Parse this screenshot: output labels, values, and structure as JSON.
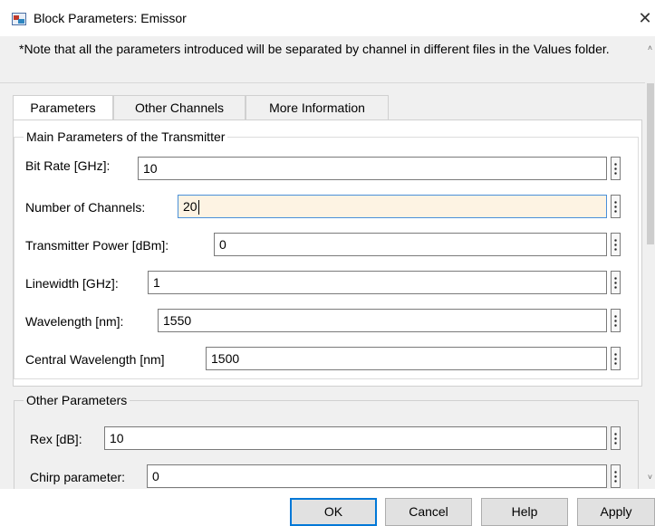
{
  "window": {
    "title": "Block Parameters: Emissor",
    "close_glyph": "✕"
  },
  "note": "*Note that all the parameters introduced will be separated by channel in different files in the Values folder.",
  "tabs": [
    {
      "label": "Parameters",
      "active": true
    },
    {
      "label": "Other Channels",
      "active": false
    },
    {
      "label": "More Information",
      "active": false
    }
  ],
  "main_group": {
    "title": "Main Parameters of the Transmitter",
    "fields": [
      {
        "label": "Bit Rate [GHz]:",
        "value": "10"
      },
      {
        "label": "Number of Channels:",
        "value": "20"
      },
      {
        "label": "Transmitter Power  [dBm]:",
        "value": "0"
      },
      {
        "label": "Linewidth [GHz]:",
        "value": "1"
      },
      {
        "label": "Wavelength [nm]:",
        "value": "1550"
      },
      {
        "label": "Central Wavelength [nm]",
        "value": "1500"
      }
    ]
  },
  "other_group": {
    "title": "Other Parameters",
    "fields": [
      {
        "label": "Rex [dB]:",
        "value": "10"
      },
      {
        "label": "Chirp parameter:",
        "value": "0"
      }
    ]
  },
  "scrollbar": {
    "up_glyph": "˄",
    "down_glyph": "˅"
  },
  "buttons": {
    "ok": "OK",
    "cancel": "Cancel",
    "help": "Help",
    "apply": "Apply"
  },
  "colors": {
    "focused_field": "#fdf3e3",
    "focus_border": "#4a90d9",
    "primary_border": "#0078d7"
  }
}
